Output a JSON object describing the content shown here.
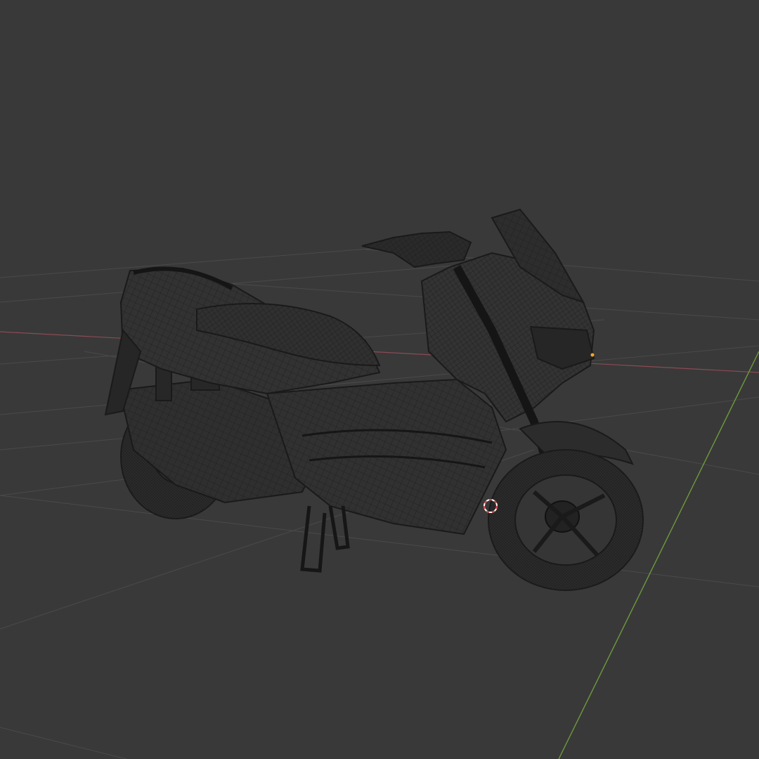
{
  "viewport": {
    "background": "#393939",
    "shading": "wireframe",
    "grid_line_color": "#4a4a4a",
    "x_axis_color": "#8c4a55",
    "y_axis_color": "#6d9a3c",
    "wire_color": "#1a1a1a",
    "object_fill": "#2e2e2e",
    "origin_dot_color": "#f3a62c",
    "cursor_color_primary": "#d94040",
    "cursor_color_secondary": "#ffffff"
  },
  "object": {
    "name_icon": "motor-scooter",
    "selected": false
  }
}
